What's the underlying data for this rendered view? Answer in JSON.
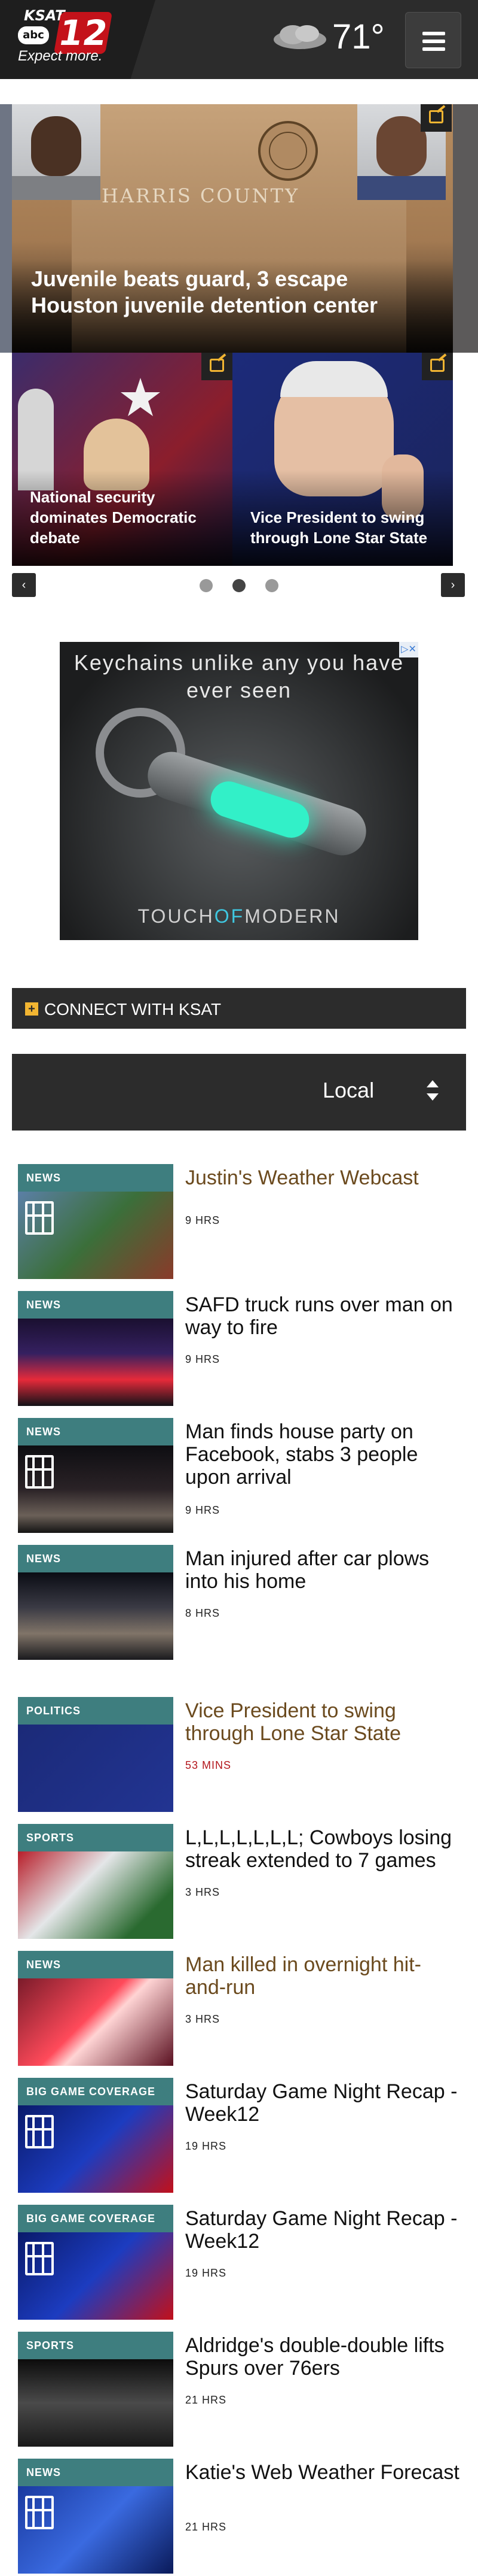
{
  "header": {
    "logo_small": "KSAT",
    "logo_network": "abc",
    "logo_number": "12",
    "tagline": "Expect more.",
    "weather": {
      "icon": "cloudy-icon",
      "temperature": "71°"
    },
    "menu_icon": "hamburger-menu-icon"
  },
  "carousel": {
    "main_slide": {
      "headline": "Juvenile beats guard, 3 escape Houston juvenile detention center",
      "building_text": "HARRIS COUNTY"
    },
    "small_slides": [
      {
        "headline": "National security dominates Democratic debate"
      },
      {
        "headline": "Vice President to swing through Lone Star State"
      }
    ],
    "prev_label": "‹",
    "next_label": "›",
    "dots": 3,
    "active_dot": 2
  },
  "ad": {
    "headline": "Keychains unlike any you have ever seen",
    "brand_left": "TOUCH",
    "brand_mid": "OF",
    "brand_right": "MODERN",
    "badge": "▷✕"
  },
  "connect": {
    "plus": "+",
    "label": "CONNECT WITH KSAT"
  },
  "section_select": {
    "value": "Local"
  },
  "stories": [
    {
      "tag": "NEWS",
      "title": "Justin's Weather Webcast",
      "time": "9 HRS",
      "video": true,
      "highlight": true
    },
    {
      "tag": "NEWS",
      "title": "SAFD truck runs over man on way to fire",
      "time": "9 HRS",
      "video": false,
      "highlight": false
    },
    {
      "tag": "NEWS",
      "title": "Man finds house party on Facebook, stabs 3 people upon arrival",
      "time": "9 HRS",
      "video": true,
      "highlight": false
    },
    {
      "tag": "NEWS",
      "title": "Man injured after car plows into his home",
      "time": "8 HRS",
      "video": false,
      "highlight": false
    },
    {
      "tag": "POLITICS",
      "title": "Vice President to swing through Lone Star State",
      "time": "53 MINS",
      "video": false,
      "highlight": true
    },
    {
      "tag": "SPORTS",
      "title": "L,L,L,L,L,L,L; Cowboys losing streak extended to 7 games",
      "time": "3 HRS",
      "video": false,
      "highlight": false
    },
    {
      "tag": "NEWS",
      "title": "Man killed in overnight hit-and-run",
      "time": "3 HRS",
      "video": false,
      "highlight": true
    },
    {
      "tag": "BIG GAME COVERAGE",
      "title": "Saturday Game Night Recap - Week12",
      "time": "19 HRS",
      "video": true,
      "highlight": false
    },
    {
      "tag": "BIG GAME COVERAGE",
      "title": "Saturday Game Night Recap - Week12",
      "time": "19 HRS",
      "video": true,
      "highlight": false
    },
    {
      "tag": "SPORTS",
      "title": "Aldridge's double-double lifts Spurs over 76ers",
      "time": "21 HRS",
      "video": false,
      "highlight": false
    },
    {
      "tag": "NEWS",
      "title": "Katie's Web Weather Forecast",
      "time": "21 HRS",
      "video": true,
      "highlight": false
    }
  ],
  "colors": {
    "header_bg": "#2c2c2c",
    "tag_teal": "#3e7e7f",
    "highlight_brown": "#6b4a1e",
    "time_red": "#b3161c",
    "accent_yellow": "#f2b532",
    "logo_red": "#c4121a"
  }
}
